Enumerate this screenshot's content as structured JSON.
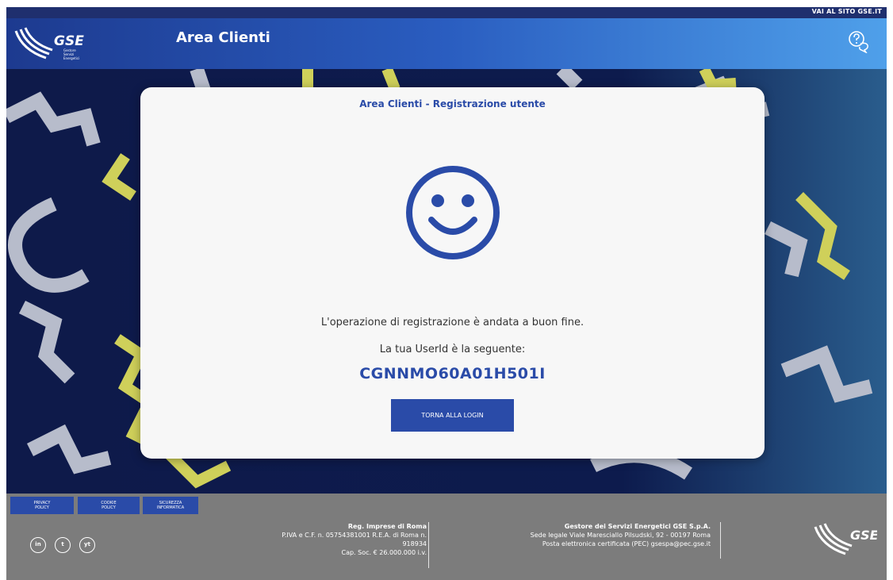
{
  "top_link": "VAI AL SITO GSE.IT",
  "header": {
    "logo_text": "GSE",
    "logo_sub": [
      "Gestore",
      "Servizi",
      "Energetici"
    ],
    "title": "Area Clienti"
  },
  "card": {
    "title": "Area Clienti - Registrazione utente",
    "message": "L'operazione di registrazione è andata a buon fine.",
    "userid_label": "La tua UserId è la seguente:",
    "userid": "CGNNMO60A01H501I",
    "button": "TORNA ALLA LOGIN"
  },
  "footer": {
    "policies": [
      {
        "line1": "PRIVACY",
        "line2": "POLICY"
      },
      {
        "line1": "COOKIE",
        "line2": "POLICY"
      },
      {
        "line1": "SICUREZZA",
        "line2": "INFORMATICA"
      }
    ],
    "social": [
      "in",
      "t",
      "yt"
    ],
    "registry": {
      "heading": "Reg. Imprese di Roma",
      "line1": "P.IVA e C.F. n. 05754381001 R.E.A. di Roma n.",
      "line2": "918934",
      "line3": "Cap. Soc. € 26.000.000 i.v."
    },
    "company": {
      "heading": "Gestore dei Servizi Energetici GSE S.p.A.",
      "line1": "Sede legale Viale Maresciallo Pilsudski, 92 - 00197 Roma",
      "line2": "Posta elettronica certificata (PEC) gsespa@pec.gse.it"
    },
    "logo_text": "GSE"
  },
  "colors": {
    "primary": "#2a4ba8",
    "header_dark": "#1d3a8f",
    "footer_bg": "#7c7c7c",
    "gear_gray": "#b7bccb",
    "gear_yellow": "#cfd05a"
  }
}
